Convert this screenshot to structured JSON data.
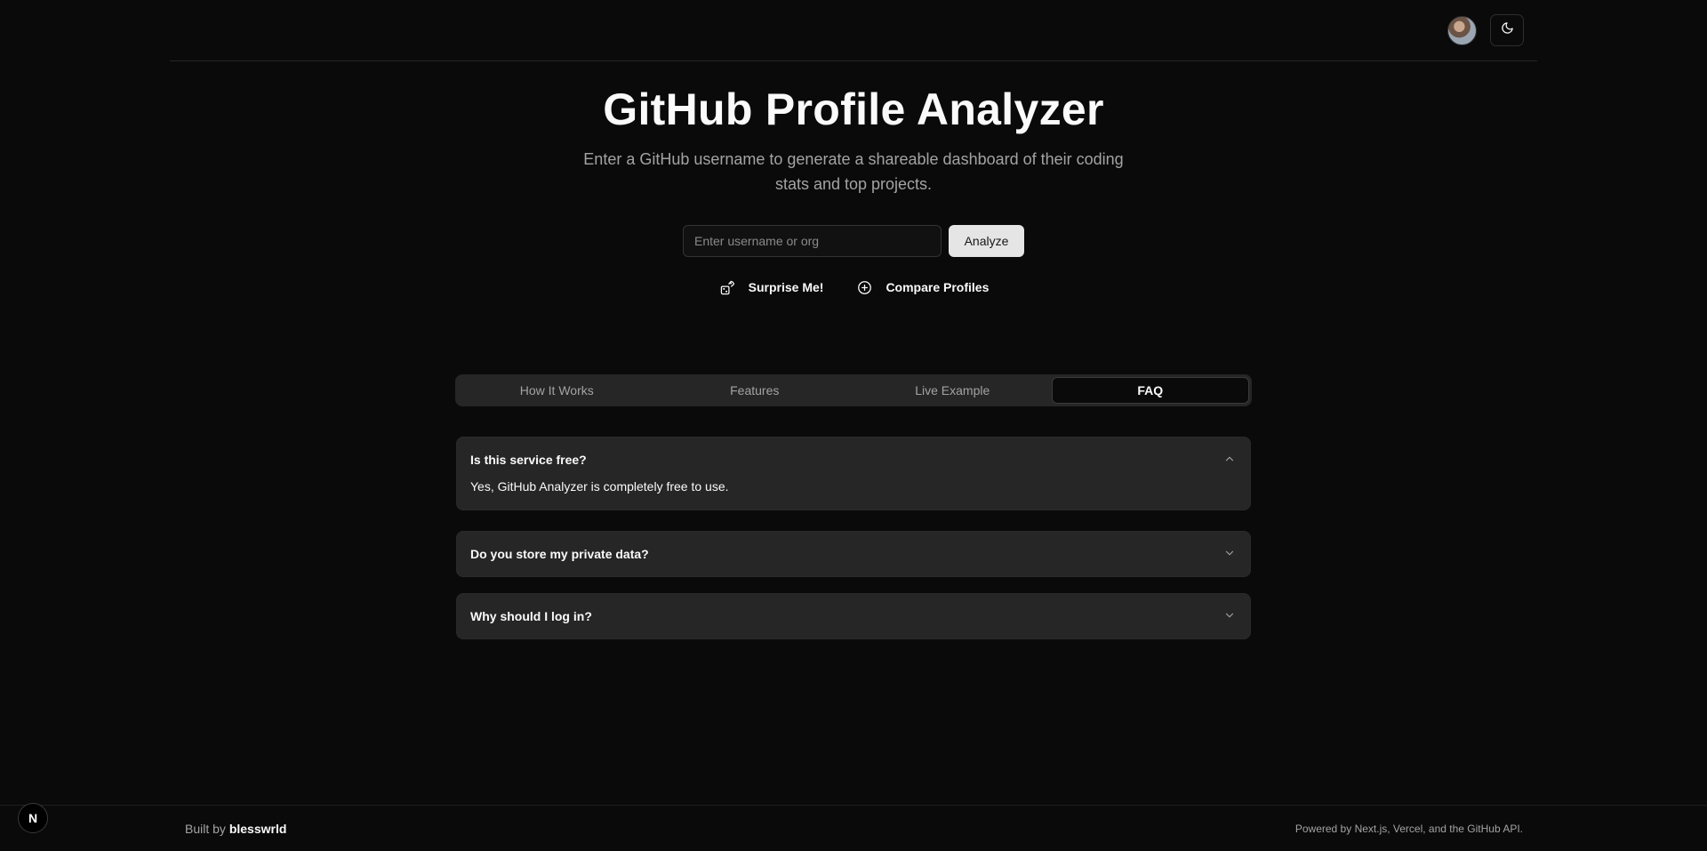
{
  "header": {
    "avatar_alt": "User avatar",
    "theme_toggle": "moon-icon"
  },
  "hero": {
    "title": "GitHub Profile Analyzer",
    "subtitle": "Enter a GitHub username to generate a shareable dashboard of their coding stats and top projects."
  },
  "search": {
    "placeholder": "Enter username or org",
    "value": "",
    "button_label": "Analyze"
  },
  "actions": [
    {
      "label": "Surprise Me!",
      "icon": "dice-icon"
    },
    {
      "label": "Compare Profiles",
      "icon": "plus-circle-icon"
    }
  ],
  "tabs": [
    {
      "label": "How It Works",
      "active": false
    },
    {
      "label": "Features",
      "active": false
    },
    {
      "label": "Live Example",
      "active": false
    },
    {
      "label": "FAQ",
      "active": true
    }
  ],
  "faq": [
    {
      "question": "Is this service free?",
      "answer": "Yes, GitHub Analyzer is completely free to use.",
      "expanded": true
    },
    {
      "question": "Do you store my private data?",
      "expanded": false
    },
    {
      "question": "Why should I log in?",
      "expanded": false
    }
  ],
  "footer": {
    "built_prefix": "Built by ",
    "built_author": "blesswrld",
    "powered": "Powered by Next.js, Vercel, and the GitHub API."
  },
  "next_badge": "N"
}
